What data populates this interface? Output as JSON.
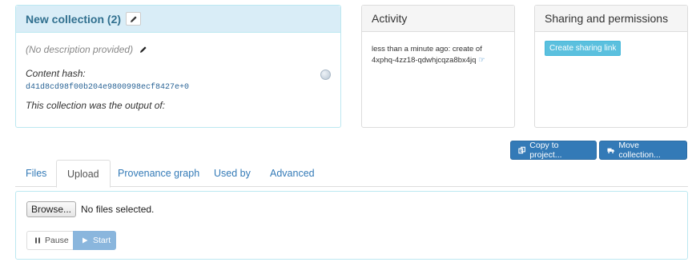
{
  "collection": {
    "title": "New collection (2)",
    "description": "(No description provided)",
    "content_hash_label": "Content hash:",
    "content_hash": "d41d8cd98f00b204e9800998ecf8427e+0",
    "output_of_label": "This collection was the output of:"
  },
  "activity": {
    "title": "Activity",
    "text": "less than a minute ago: create of 4xphq-4zz18-qdwhjcqza8bx4jq"
  },
  "sharing": {
    "title": "Sharing and permissions",
    "create_link_label": "Create sharing link"
  },
  "actions": {
    "copy_label": "Copy to project...",
    "move_label": "Move collection..."
  },
  "tabs": [
    {
      "label": "Files"
    },
    {
      "label": "Upload"
    },
    {
      "label": "Provenance graph"
    },
    {
      "label": "Used by"
    },
    {
      "label": "Advanced"
    }
  ],
  "active_tab": "Upload",
  "upload": {
    "browse_label": "Browse...",
    "file_status": "No files selected.",
    "pause_label": "Pause",
    "start_label": "Start"
  },
  "colors": {
    "accent": "#337ab7",
    "info": "#5bc0de",
    "panel_info_bg": "#d9edf7"
  }
}
